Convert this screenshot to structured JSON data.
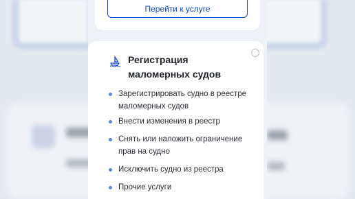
{
  "top_card": {
    "button_label": "Перейти к услуге"
  },
  "service_card": {
    "icon": "boat-icon",
    "title": "Регистрация маломерных судов",
    "items": [
      "Зарегистрировать судно в реестре маломерных судов",
      "Внести изменения в реестр",
      "Снять или наложить ограничение прав на судно",
      "Исключить судно из реестра",
      "Прочие услуги"
    ]
  },
  "colors": {
    "accent": "#0d4cd3",
    "bullet": "#5a83d6",
    "background": "#eef1f6"
  }
}
